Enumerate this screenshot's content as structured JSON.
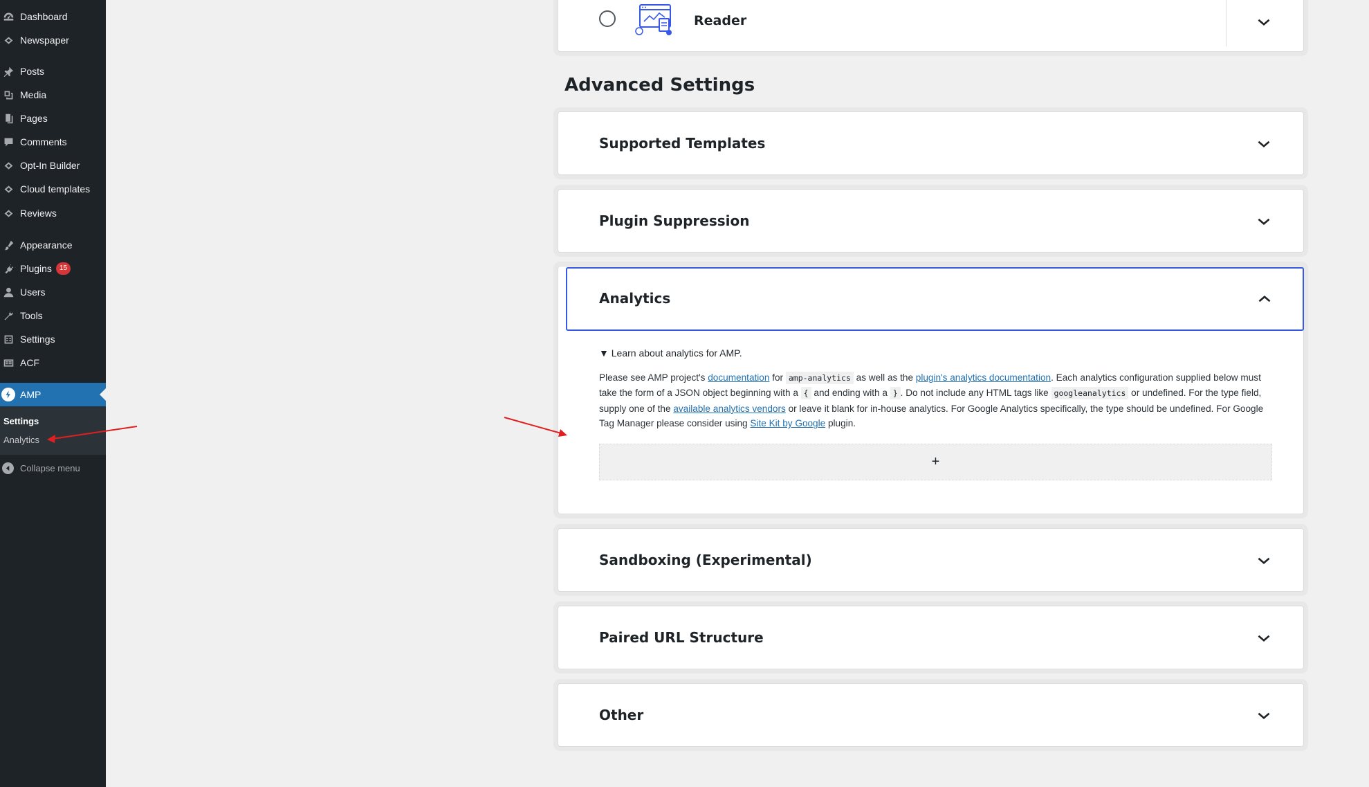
{
  "sidebar": {
    "items": [
      {
        "label": "Dashboard",
        "icon": "dashboard-icon"
      },
      {
        "label": "Newspaper",
        "icon": "newspaper-icon"
      },
      {
        "label": "Posts",
        "icon": "pin-icon"
      },
      {
        "label": "Media",
        "icon": "media-icon"
      },
      {
        "label": "Pages",
        "icon": "pages-icon"
      },
      {
        "label": "Comments",
        "icon": "comment-icon"
      },
      {
        "label": "Opt-In Builder",
        "icon": "opt-in-icon"
      },
      {
        "label": "Cloud templates",
        "icon": "cloud-templates-icon"
      },
      {
        "label": "Reviews",
        "icon": "reviews-icon"
      },
      {
        "label": "Appearance",
        "icon": "brush-icon"
      },
      {
        "label": "Plugins",
        "icon": "plugin-icon",
        "badge": "15"
      },
      {
        "label": "Users",
        "icon": "users-icon"
      },
      {
        "label": "Tools",
        "icon": "wrench-icon"
      },
      {
        "label": "Settings",
        "icon": "settings-icon"
      },
      {
        "label": "ACF",
        "icon": "acf-icon"
      }
    ],
    "active": {
      "label": "AMP",
      "icon": "amp-icon"
    },
    "submenu": {
      "current": "Settings",
      "second": "Analytics"
    },
    "collapse_label": "Collapse menu"
  },
  "reader": {
    "label": "Reader"
  },
  "advanced_settings_heading": "Advanced Settings",
  "panels": {
    "supported_templates": "Supported Templates",
    "plugin_suppression": "Plugin Suppression",
    "analytics": "Analytics",
    "sandboxing": "Sandboxing (Experimental)",
    "paired_url": "Paired URL Structure",
    "other": "Other"
  },
  "analytics_panel": {
    "details_summary": "Learn about analytics for AMP.",
    "text": {
      "t1": "Please see AMP project's ",
      "link1": "documentation",
      "t2": " for ",
      "code1": "amp-analytics",
      "t3": " as well as the ",
      "link2": "plugin's analytics documentation",
      "t4": ". Each analytics configuration supplied below must take the form of a JSON object beginning with a ",
      "code2": "{",
      "t5": " and ending with a ",
      "code3": "}",
      "t6": ". Do not include any HTML tags like ",
      "code4": "googleanalytics",
      "t7": " or undefined. For the type field, supply one of the ",
      "link3": "available analytics vendors",
      "t8": " or leave it blank for in-house analytics. For Google Analytics specifically, the type should be undefined. For Google Tag Manager please consider using ",
      "link4": "Site Kit by Google",
      "t9": " plugin."
    },
    "add_button": "+"
  },
  "colors": {
    "sidebar_bg": "#1d2327",
    "active_blue": "#2271b1",
    "focus_border": "#3858e9",
    "badge_red": "#d63638",
    "annotation_red": "#e02020"
  }
}
